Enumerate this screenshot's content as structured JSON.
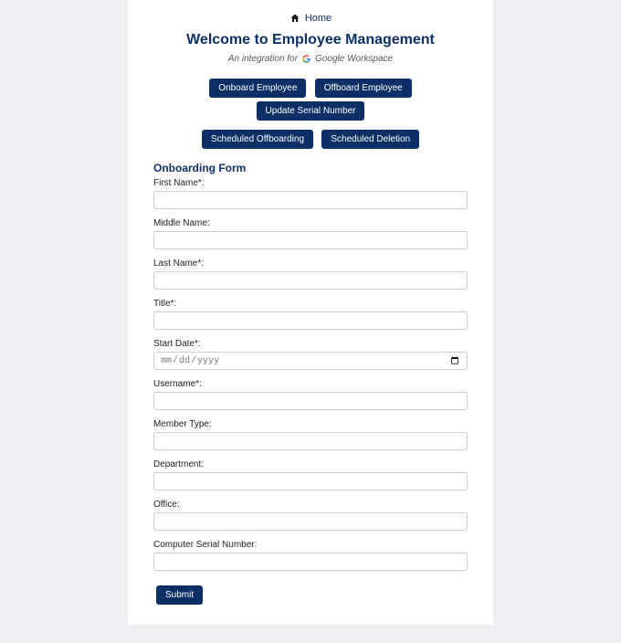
{
  "header": {
    "home_label": "Home",
    "title": "Welcome to Employee Management",
    "subtitle_prefix": "An integration for",
    "subtitle_suffix": "Google Workspace"
  },
  "actions": {
    "onboard": "Onboard Employee",
    "offboard": "Offboard Employee",
    "update_serial": "Update Serial Number",
    "scheduled_offboarding": "Scheduled Offboarding",
    "scheduled_deletion": "Scheduled Deletion"
  },
  "form": {
    "title": "Onboarding Form",
    "fields": {
      "first_name": {
        "label": "First Name*:",
        "value": ""
      },
      "middle_name": {
        "label": "Middle Name:",
        "value": ""
      },
      "last_name": {
        "label": "Last Name*:",
        "value": ""
      },
      "title": {
        "label": "Title*:",
        "value": ""
      },
      "start_date": {
        "label": "Start Date*:",
        "value": "",
        "placeholder": "mm/dd/yyyy"
      },
      "username": {
        "label": "Username*:",
        "value": ""
      },
      "member_type": {
        "label": "Member Type:",
        "value": ""
      },
      "department": {
        "label": "Department:",
        "value": ""
      },
      "office": {
        "label": "Office:",
        "value": ""
      },
      "serial": {
        "label": "Computer Serial Number:",
        "value": ""
      }
    },
    "submit_label": "Submit"
  }
}
